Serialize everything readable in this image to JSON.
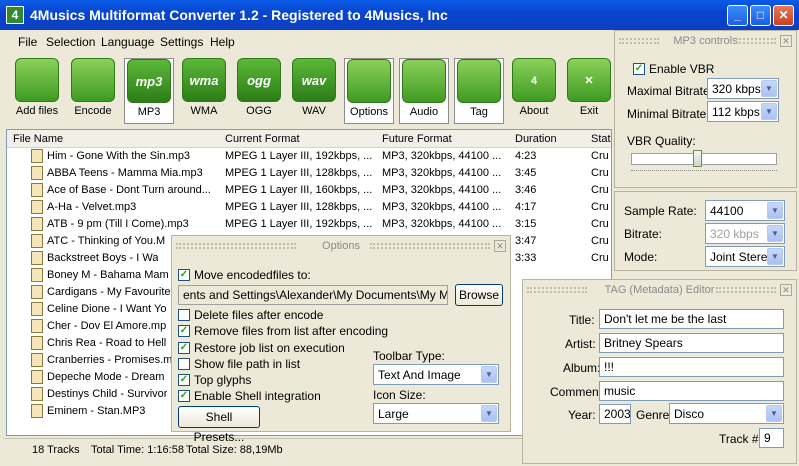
{
  "window": {
    "title": "4Musics Multiformat Converter  1.2 - Registered to 4Musics, Inc",
    "app_icon": "4"
  },
  "menu": [
    "File",
    "Selection",
    "Language",
    "Settings",
    "Help"
  ],
  "toolbar": [
    {
      "label": "Add files",
      "icon": "add-files-icon",
      "glyph": ""
    },
    {
      "label": "Encode",
      "icon": "encode-icon",
      "glyph": ""
    },
    {
      "label": "MP3",
      "icon": "mp3-icon",
      "glyph": "mp3",
      "selected": true
    },
    {
      "label": "WMA",
      "icon": "wma-icon",
      "glyph": "wma"
    },
    {
      "label": "OGG",
      "icon": "ogg-icon",
      "glyph": "ogg"
    },
    {
      "label": "WAV",
      "icon": "wav-icon",
      "glyph": "wav"
    },
    {
      "label": "Options",
      "icon": "options-icon",
      "glyph": ""
    },
    {
      "label": "Audio",
      "icon": "audio-icon",
      "glyph": ""
    },
    {
      "label": "Tag",
      "icon": "tag-icon",
      "glyph": ""
    },
    {
      "label": "About",
      "icon": "about-icon",
      "glyph": "4"
    },
    {
      "label": "Exit",
      "icon": "exit-icon",
      "glyph": "✕"
    }
  ],
  "list": {
    "headers": [
      "File Name",
      "Current Format",
      "Future Format",
      "Duration",
      "Stat"
    ],
    "rows": [
      [
        "Him - Gone With the Sin.mp3",
        "MPEG 1 Layer III, 192kbps, ...",
        "MP3, 320kbps, 44100 ...",
        "4:23",
        "Cru"
      ],
      [
        "ABBA Teens - Mamma Mia.mp3",
        "MPEG 1 Layer III, 128kbps, ...",
        "MP3, 320kbps, 44100 ...",
        "3:45",
        "Cru"
      ],
      [
        "Ace of Base - Dont Turn around...",
        "MPEG 1 Layer III, 160kbps, ...",
        "MP3, 320kbps, 44100 ...",
        "3:46",
        "Cru"
      ],
      [
        "A-Ha - Velvet.mp3",
        "MPEG 1 Layer III, 128kbps, ...",
        "MP3, 320kbps, 44100 ...",
        "4:17",
        "Cru"
      ],
      [
        "ATB - 9 pm (Till I Come).mp3",
        "MPEG 1 Layer III, 192kbps, ...",
        "MP3, 320kbps, 44100 ...",
        "3:15",
        "Cru"
      ],
      [
        "ATC - Thinking of You.M",
        "",
        "",
        "3:47",
        "Cru"
      ],
      [
        "Backstreet Boys - I Wa",
        "",
        "",
        "3:33",
        "Cru"
      ],
      [
        "Boney M - Bahama Mam",
        "",
        "",
        "",
        ""
      ],
      [
        "Cardigans - My Favourite",
        "",
        "",
        "",
        ""
      ],
      [
        "Celine Dione - I Want Yo",
        "",
        "",
        "",
        ""
      ],
      [
        "Cher - Dov El Amore.mp",
        "",
        "",
        "",
        ""
      ],
      [
        "Chris Rea - Road to Hell",
        "",
        "",
        "",
        ""
      ],
      [
        "Cranberries - Promises.m",
        "",
        "",
        "",
        ""
      ],
      [
        "Depeche Mode - Dream",
        "",
        "",
        "",
        ""
      ],
      [
        "Destinys Child - Survivor",
        "",
        "",
        "",
        ""
      ],
      [
        "Eminem - Stan.MP3",
        "",
        "",
        "",
        ""
      ]
    ]
  },
  "status": {
    "tracks": "18 Tracks",
    "total_time": "Total Time: 1:16:58",
    "total_size": "Total Size: 88,19Mb"
  },
  "mp3": {
    "title": "MP3 controls",
    "enable_vbr": "Enable VBR",
    "max_label": "Maximal Bitrate:",
    "max_value": "320 kbps",
    "min_label": "Minimal Bitrate:",
    "min_value": "112 kbps",
    "vbr_quality": "VBR Quality:",
    "vbr_quality_level": 0.45
  },
  "audio": {
    "sample_label": "Sample Rate:",
    "sample_value": "44100",
    "bitrate_label": "Bitrate:",
    "bitrate_value": "320 kbps",
    "mode_label": "Mode:",
    "mode_value": "Joint Stereo"
  },
  "options": {
    "title": "Options",
    "move": "Move encodedfiles to:",
    "path": "ents and Settings\\Alexander\\My Documents\\My Music",
    "browse": "Browse",
    "delete": "Delete files after encode",
    "remove": "Remove files from list after encoding",
    "restore": "Restore job list on execution",
    "showpath": "Show file path in list",
    "glyphs": "Top glyphs",
    "shell": "Enable Shell integration",
    "presets": "Shell Presets...",
    "tb_type_label": "Toolbar Type:",
    "tb_type_value": "Text And Image",
    "icon_size_label": "Icon Size:",
    "icon_size_value": "Large"
  },
  "tag": {
    "title": "TAG (Metadata) Editor",
    "title_label": "Title:",
    "title_value": "Don't let me be the last",
    "artist_label": "Artist:",
    "artist_value": "Britney Spears",
    "album_label": "Album:",
    "album_value": "!!!",
    "comment_label": "Comment",
    "comment_value": "music",
    "year_label": "Year:",
    "year_value": "2003",
    "genre_label": "Genre:",
    "genre_value": "Disco",
    "track_label": "Track #",
    "track_value": "9"
  }
}
